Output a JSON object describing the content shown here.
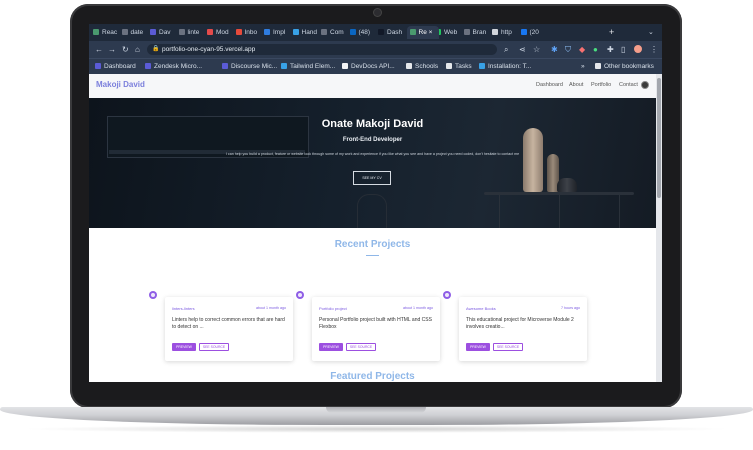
{
  "browser": {
    "tabs": [
      {
        "label": "Reac",
        "color": "#4a9a6f"
      },
      {
        "label": "date",
        "color": "#6b7280"
      },
      {
        "label": "Dav",
        "color": "#5b5bd6"
      },
      {
        "label": "linte",
        "color": "#6b7280"
      },
      {
        "label": "Mod",
        "color": "#e44b4b"
      },
      {
        "label": "Inbo",
        "color": "#e64a3b"
      },
      {
        "label": "Impl",
        "color": "#2f7de1"
      },
      {
        "label": "Hand",
        "color": "#38a1e6"
      },
      {
        "label": "Com",
        "color": "#6b7280"
      },
      {
        "label": "(48)",
        "color": "#0a66c2"
      },
      {
        "label": "Dash",
        "color": "#111827"
      },
      {
        "label": "Re",
        "color": "#4a9a6f"
      },
      {
        "label": "Web",
        "color": "#22c55e"
      },
      {
        "label": "Bran",
        "color": "#6b7280"
      },
      {
        "label": "http",
        "color": "#d1d5db"
      },
      {
        "label": "(20",
        "color": "#1877f2"
      }
    ],
    "new_tab": "+",
    "url": "portfolio-one-cyan-95.vercel.app",
    "bookmarks": [
      {
        "label": "Dashboard",
        "color": "#5b5bd6"
      },
      {
        "label": "Zendesk Micro...",
        "color": "#5b5bd6"
      },
      {
        "label": "Discourse Mic...",
        "color": "#5b5bd6"
      },
      {
        "label": "Tailwind Elem...",
        "color": "#38a1e6"
      },
      {
        "label": "DevDocs API...",
        "color": "#f3f4f6"
      },
      {
        "label": "Schools",
        "color": "#e5e7eb"
      },
      {
        "label": "Tasks",
        "color": "#e5e7eb"
      },
      {
        "label": "Installation: T...",
        "color": "#38a1e6"
      }
    ],
    "more": "»",
    "other_bookmarks": "Other bookmarks"
  },
  "site": {
    "brand": "Makoji David",
    "nav": [
      "Dashboard",
      "About",
      "Portfolio",
      "Contact"
    ],
    "hero": {
      "name": "Onate Makoji David",
      "role": "Front-End Developer",
      "description": "I can help you build a product, feature or website look through some of my work and experience if you like what you see and have a project you need coded, don't hesitate to contact me",
      "button": "SEE MY CV"
    },
    "recent_title": "Recent Projects",
    "projects": [
      {
        "name": "linters-linters",
        "meta": "about 1 month ago",
        "description": "Linters help to correct common errors that are hard to detect on ...",
        "preview": "PREVIEW",
        "source": "SEE SOURCE"
      },
      {
        "name": "Portfolio project",
        "meta": "about 1 month ago",
        "description": "Personal Portfolio project built with HTML and CSS Flexbox",
        "preview": "PREVIEW",
        "source": "SEE SOURCE"
      },
      {
        "name": "Awesome Books",
        "meta": "7 hours ago",
        "description": "This educational project for Microverse Module 2 involves creatio...",
        "preview": "PREVIEW",
        "source": "SEE SOURCE"
      }
    ],
    "featured_title": "Featured Projects"
  },
  "colors": {
    "accent": "#9c4fe0",
    "brand": "#7b7fdc",
    "section_title": "#8fb7e8",
    "hero_bg": "#15202c"
  }
}
